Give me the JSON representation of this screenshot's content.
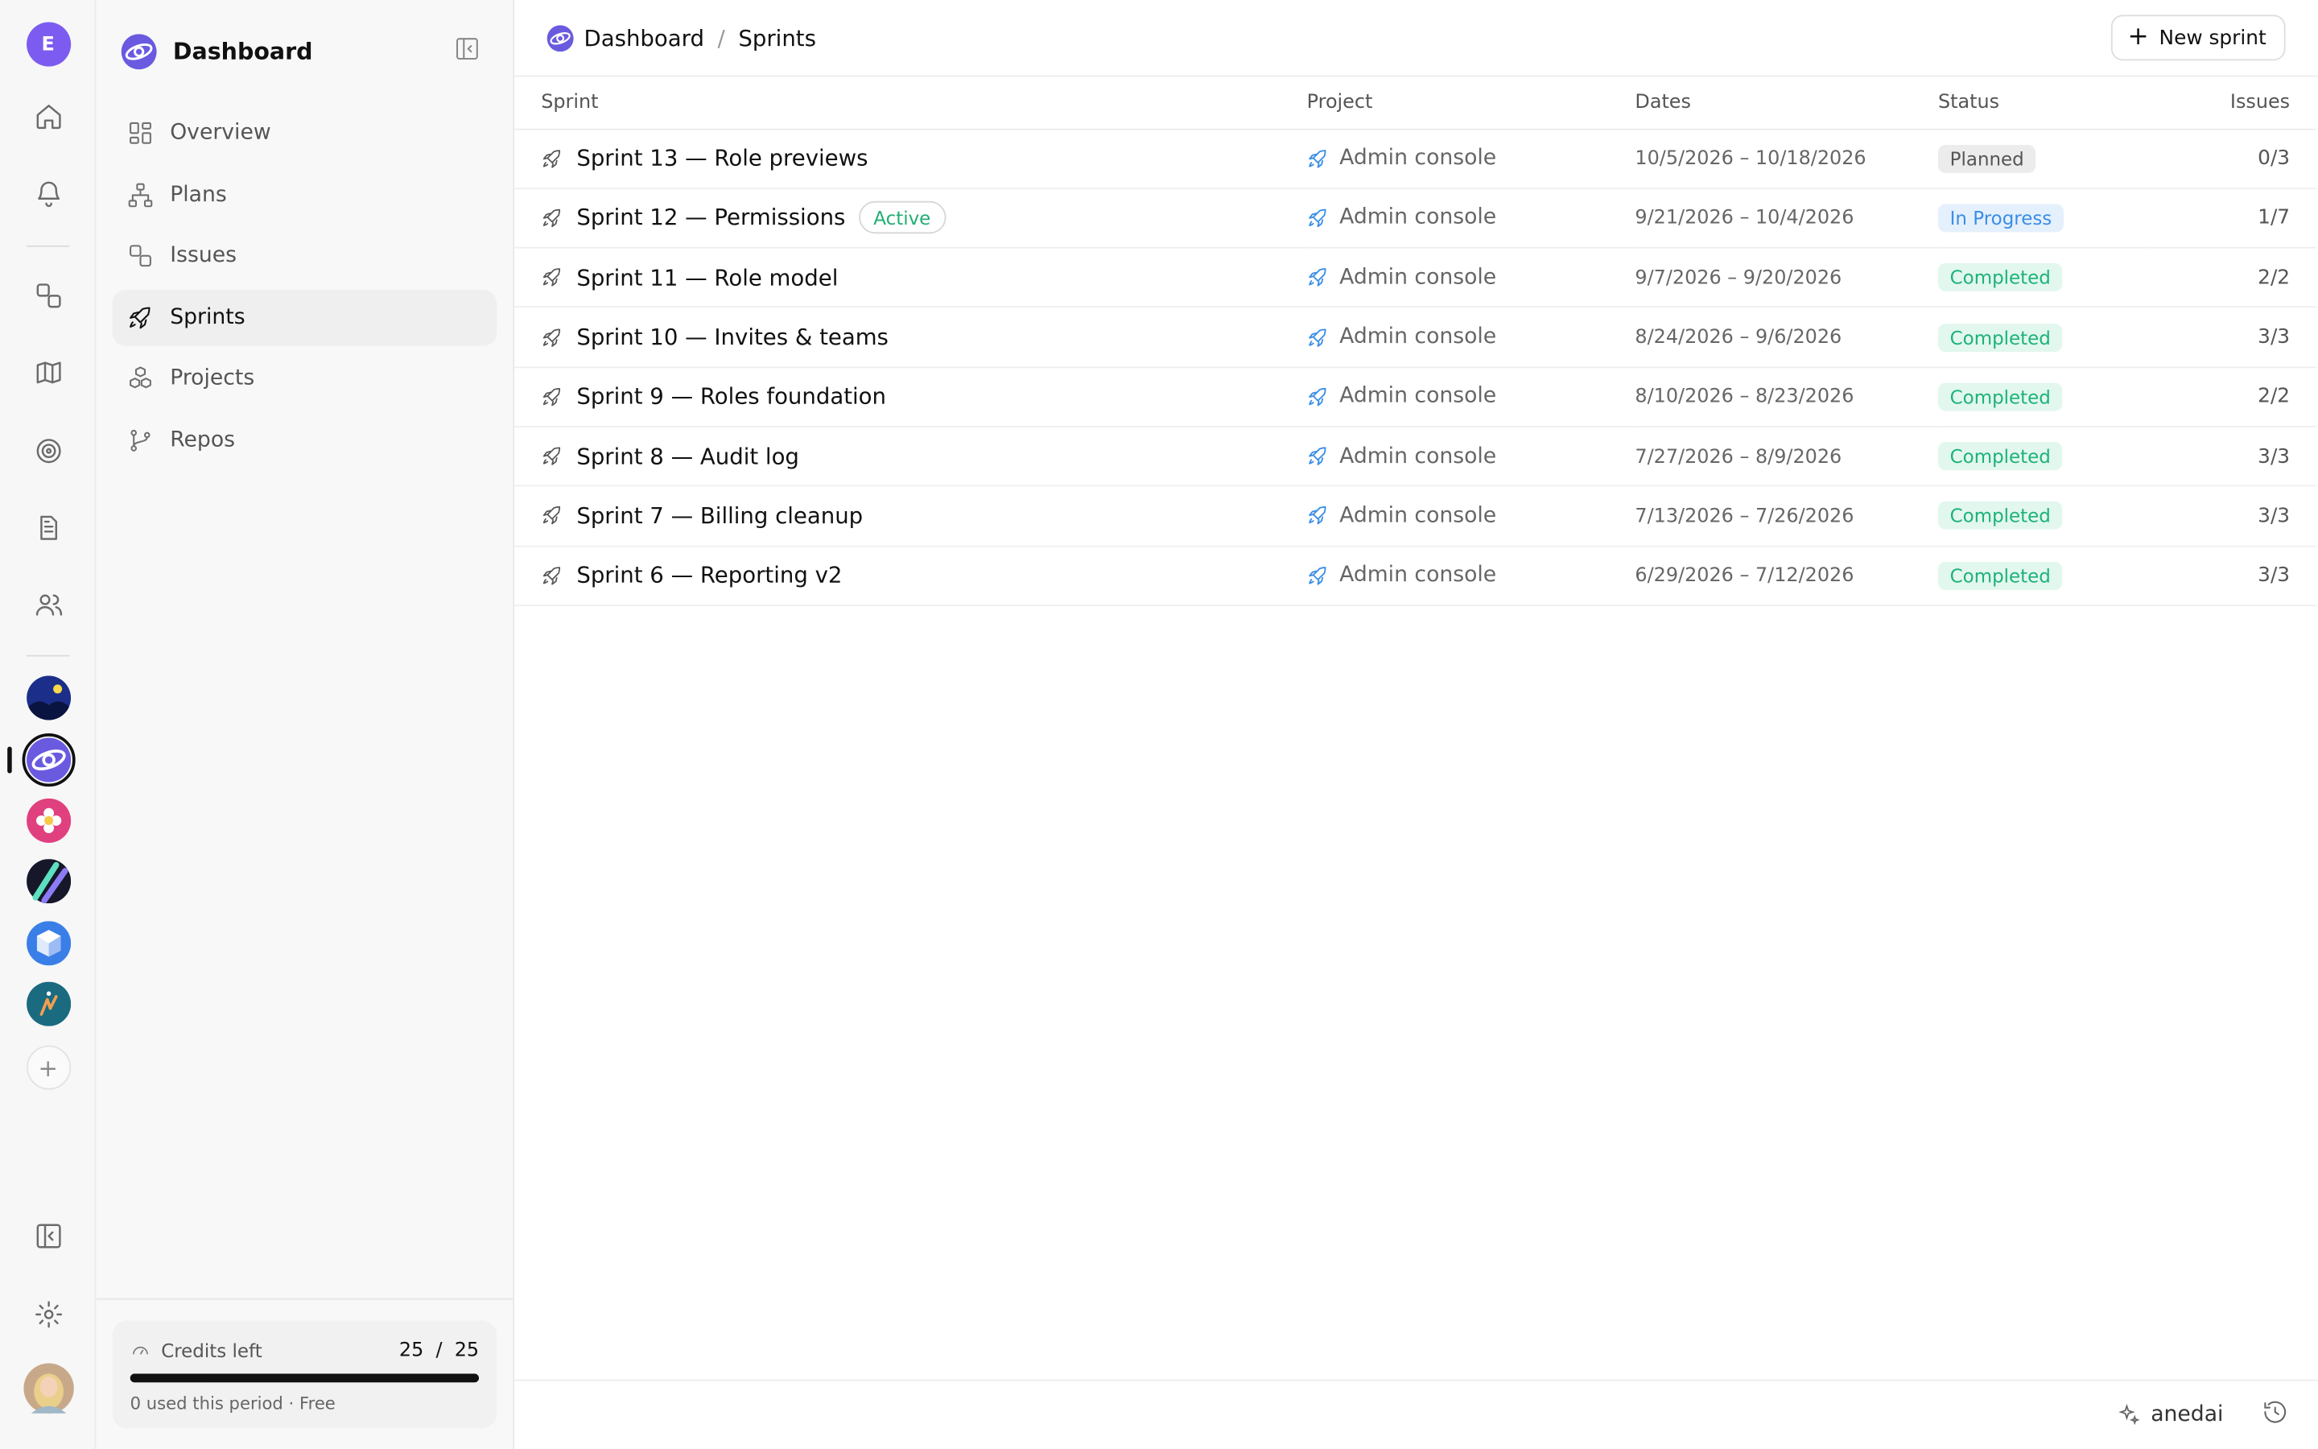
{
  "rail": {
    "user_initial": "E",
    "icons": [
      "home-icon",
      "bell-icon",
      "issues-icon",
      "map-icon",
      "target-icon",
      "document-icon",
      "users-icon",
      "sidebar-toggle-icon",
      "gear-icon"
    ],
    "workspaces": [
      "workspace-night-sky",
      "workspace-dashboard",
      "workspace-flower",
      "workspace-stripes",
      "workspace-cube",
      "workspace-teal"
    ],
    "add_label": "+"
  },
  "sidebar": {
    "title": "Dashboard",
    "items": [
      {
        "label": "Overview",
        "icon": "grid-icon"
      },
      {
        "label": "Plans",
        "icon": "hierarchy-icon"
      },
      {
        "label": "Issues",
        "icon": "issues-icon"
      },
      {
        "label": "Sprints",
        "icon": "rocket-icon",
        "active": true
      },
      {
        "label": "Projects",
        "icon": "cubes-icon"
      },
      {
        "label": "Repos",
        "icon": "branch-icon"
      }
    ],
    "credits": {
      "label": "Credits left",
      "used": 25,
      "total": 25,
      "count_text": "25  /  25",
      "fill_fraction": 1.0,
      "subtext": "0 used this period · Free"
    }
  },
  "topbar": {
    "breadcrumb": [
      "Dashboard",
      "/",
      "Sprints"
    ],
    "new_button": "New sprint"
  },
  "table": {
    "headers": {
      "sprint": "Sprint",
      "project": "Project",
      "dates": "Dates",
      "status": "Status",
      "issues": "Issues"
    },
    "rows": [
      {
        "name": "Sprint 13 — Role previews",
        "badge": "",
        "project": "Admin console",
        "dates": "10/5/2026 – 10/18/2026",
        "status": "Planned",
        "issues": "0/3"
      },
      {
        "name": "Sprint 12 — Permissions",
        "badge": "Active",
        "project": "Admin console",
        "dates": "9/21/2026 – 10/4/2026",
        "status": "In Progress",
        "issues": "1/7"
      },
      {
        "name": "Sprint 11 — Role model",
        "badge": "",
        "project": "Admin console",
        "dates": "9/7/2026 – 9/20/2026",
        "status": "Completed",
        "issues": "2/2"
      },
      {
        "name": "Sprint 10 — Invites & teams",
        "badge": "",
        "project": "Admin console",
        "dates": "8/24/2026 – 9/6/2026",
        "status": "Completed",
        "issues": "3/3"
      },
      {
        "name": "Sprint 9 — Roles foundation",
        "badge": "",
        "project": "Admin console",
        "dates": "8/10/2026 – 8/23/2026",
        "status": "Completed",
        "issues": "2/2"
      },
      {
        "name": "Sprint 8 — Audit log",
        "badge": "",
        "project": "Admin console",
        "dates": "7/27/2026 – 8/9/2026",
        "status": "Completed",
        "issues": "3/3"
      },
      {
        "name": "Sprint 7 — Billing cleanup",
        "badge": "",
        "project": "Admin console",
        "dates": "7/13/2026 – 7/26/2026",
        "status": "Completed",
        "issues": "3/3"
      },
      {
        "name": "Sprint 6 — Reporting v2",
        "badge": "",
        "project": "Admin console",
        "dates": "6/29/2026 – 7/12/2026",
        "status": "Completed",
        "issues": "3/3"
      }
    ]
  },
  "bottombar": {
    "user": "anedai"
  },
  "colors": {
    "accent": "#7c5cf0",
    "completed": "#1db27a",
    "in_progress": "#3a8ee6",
    "planned": "#555555"
  }
}
